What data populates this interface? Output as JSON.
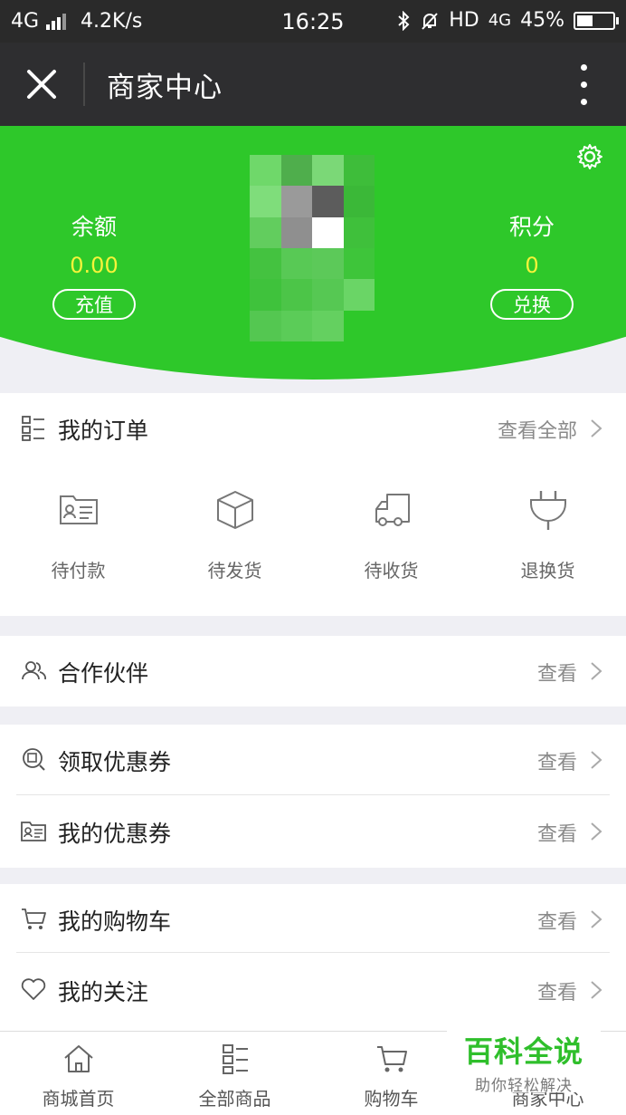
{
  "status_bar": {
    "network": "4G",
    "speed": "4.2K/s",
    "time": "16:25",
    "hd": "HD",
    "net2": "4G",
    "battery": "45%",
    "battery_level": 0.45
  },
  "header": {
    "title": "商家中心"
  },
  "hero": {
    "balance_label": "余额",
    "balance_value": "0.00",
    "recharge_label": "充值",
    "points_label": "积分",
    "points_value": "0",
    "exchange_label": "兑换",
    "bg_color": "#2ec82a",
    "value_color": "#f6f33a"
  },
  "orders": {
    "title": "我的订单",
    "view_all": "查看全部",
    "statuses": [
      {
        "label": "待付款",
        "icon": "id-card-icon"
      },
      {
        "label": "待发货",
        "icon": "box-icon"
      },
      {
        "label": "待收货",
        "icon": "truck-icon"
      },
      {
        "label": "退换货",
        "icon": "plug-icon"
      }
    ]
  },
  "partners": {
    "label": "合作伙伴",
    "action": "查看"
  },
  "coupons": {
    "get_label": "领取优惠券",
    "get_action": "查看",
    "mine_label": "我的优惠券",
    "mine_action": "查看"
  },
  "shopping": {
    "cart_label": "我的购物车",
    "cart_action": "查看",
    "follow_label": "我的关注",
    "follow_action": "查看"
  },
  "tabbar": {
    "items": [
      {
        "label": "商城首页",
        "icon": "home-icon"
      },
      {
        "label": "全部商品",
        "icon": "grid-list-icon"
      },
      {
        "label": "购物车",
        "icon": "cart-icon"
      },
      {
        "label": "商家中心",
        "icon": "user-icon"
      }
    ]
  },
  "watermark": {
    "title": "百科全说",
    "subtitle": "助你轻松解决"
  }
}
